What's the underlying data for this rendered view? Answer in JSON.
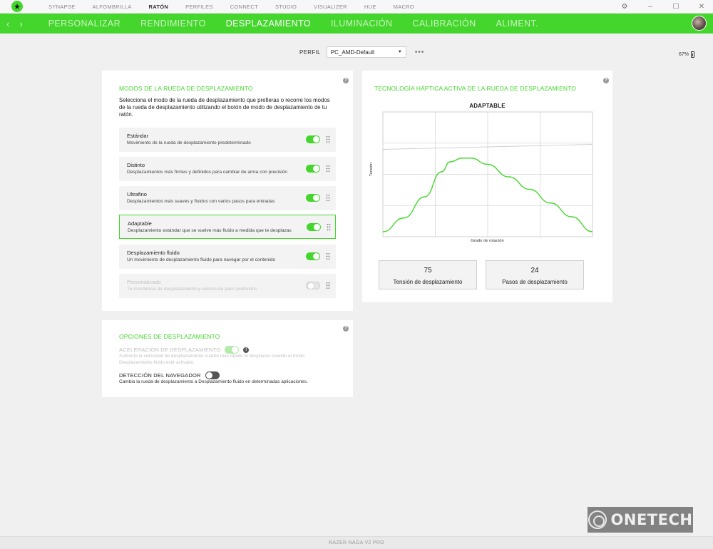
{
  "topnav": {
    "items": [
      "SYNAPSE",
      "ALFOMBRILLA",
      "RATÓN",
      "PERFILES",
      "CONNECT",
      "STUDIO",
      "VISUALIZER",
      "HUE",
      "MACRO"
    ],
    "active": "RATÓN"
  },
  "subnav": {
    "tabs": [
      "PERSONALIZAR",
      "RENDIMIENTO",
      "DESPLAZAMIENTO",
      "ILUMINACIÓN",
      "CALIBRACIÓN",
      "ALIMENT."
    ],
    "active": "DESPLAZAMIENTO"
  },
  "profile": {
    "label": "PERFIL",
    "value": "PC_AMD-Default",
    "more": "•••"
  },
  "battery": {
    "percent": "67%"
  },
  "modes_panel": {
    "title": "MODOS DE LA RUEDA DE DESPLAZAMIENTO",
    "description": "Selecciona el modo de la rueda de desplazamiento que prefieras o recorre los modos de la rueda de desplazamiento utilizando el botón de modo de desplazamiento de tu ratón.",
    "modes": [
      {
        "name": "Estándar",
        "desc": "Movimiento de la rueda de desplazamiento predeterminado",
        "enabled": true
      },
      {
        "name": "Distinto",
        "desc": "Desplazamientos más firmes y definidos para cambiar de arma con precisión",
        "enabled": true
      },
      {
        "name": "Ultrafino",
        "desc": "Desplazamientos más suaves y fluidos con varios pasos para entradas",
        "enabled": true
      },
      {
        "name": "Adaptable",
        "desc": "Desplazamiento estándar que se vuelve más fluido a medida que te desplazas",
        "enabled": true
      },
      {
        "name": "Desplazamiento fluido",
        "desc": "Un movimiento de desplazamiento fluido para navegar por el contenido",
        "enabled": true
      },
      {
        "name": "Personalizado",
        "desc": "Tu resistencia de desplazamiento y valores de paso preferidos",
        "enabled": false
      }
    ]
  },
  "options_panel": {
    "title": "OPCIONES DE DESPLAZAMIENTO",
    "accel_label": "ACELERACIÓN DE DESPLAZAMIENTO",
    "accel_desc": "Aumenta la velocidad de desplazamiento cuanto más rápido te desplaces cuando el modo Desplazamiento fluido esté activado.",
    "browser_label": "DETECCIÓN DEL NAVEGADOR",
    "browser_desc": "Cambia la rueda de desplazamiento a Desplazamiento fluido en determinadas aplicaciones."
  },
  "haptic_panel": {
    "title": "TECNOLOGÍA HÁPTICA ACTIVA DE LA RUEDA DE DESPLAZAMIENTO",
    "tension_value": "75",
    "tension_label": "Tensión de desplazamiento",
    "steps_value": "24",
    "steps_label": "Pasos de desplazamiento"
  },
  "chart_data": {
    "type": "line",
    "title": "ADAPTABLE",
    "xlabel": "Grado de rotación",
    "ylabel": "Tensión",
    "grid": true,
    "series": [
      {
        "x": [
          0,
          0.1,
          0.2,
          0.28,
          0.32,
          0.38,
          0.42,
          0.5,
          0.6,
          0.7,
          0.8,
          0.9,
          1.0
        ],
        "y": [
          0.04,
          0.15,
          0.32,
          0.52,
          0.6,
          0.63,
          0.63,
          0.58,
          0.48,
          0.38,
          0.27,
          0.16,
          0.04
        ]
      },
      {
        "x": [
          0,
          1
        ],
        "y": [
          0.7,
          0.74
        ]
      }
    ]
  },
  "footer": {
    "device": "RAZER NAGA V2 PRO"
  },
  "watermark": {
    "text": "ONETECH"
  }
}
